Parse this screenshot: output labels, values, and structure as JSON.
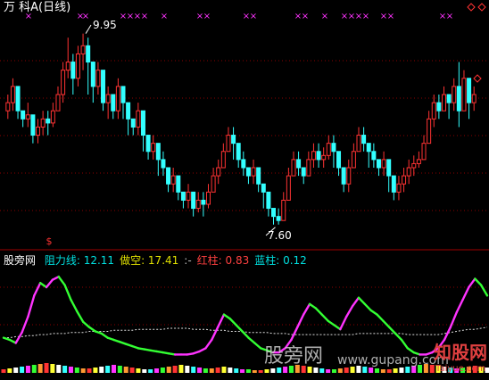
{
  "header": {
    "title": "万  科A(日线)"
  },
  "annotations": {
    "high": "9.95",
    "low": "7.60"
  },
  "indicator": {
    "name": "股旁网",
    "items": [
      {
        "label": "阻力线: 12.11",
        "color": "#00e0e0"
      },
      {
        "label": "做空: 17.41",
        "color": "#e0e000"
      },
      {
        "label": ":-",
        "color": "#bbbbbb"
      },
      {
        "label": "红柱: 0.83",
        "color": "#ff4040"
      },
      {
        "label": "蓝柱: 0.12",
        "color": "#00e0e0"
      }
    ]
  },
  "watermark": {
    "left": "股旁网",
    "site": "www.gupang.com",
    "right": "知股网",
    "right_sub": "Taiyue.com"
  },
  "colors": {
    "up": "#ff3333",
    "down": "#33ffff",
    "grid": "#8b0000",
    "magenta": "#ff33ff",
    "green": "#33ff33"
  },
  "chart_data": [
    {
      "type": "candlestick",
      "title": "万  科A(日线)",
      "ylim": [
        7.4,
        10.1
      ],
      "high_mark": 9.95,
      "low_mark": 7.6,
      "signal_marker": "$",
      "close": [
        9.1,
        9.3,
        9.0,
        8.9,
        8.95,
        8.7,
        8.8,
        8.9,
        8.85,
        9.0,
        9.2,
        9.5,
        9.6,
        9.4,
        9.7,
        9.8,
        9.6,
        9.3,
        9.5,
        9.1,
        9.2,
        9.0,
        9.3,
        9.1,
        8.9,
        8.8,
        9.0,
        8.7,
        8.5,
        8.6,
        8.4,
        8.3,
        8.1,
        8.2,
        8.0,
        7.9,
        8.0,
        7.8,
        7.9,
        7.85,
        8.0,
        8.2,
        8.3,
        8.5,
        8.7,
        8.6,
        8.4,
        8.3,
        8.2,
        8.3,
        8.1,
        8.0,
        7.8,
        7.7,
        7.65,
        7.9,
        8.2,
        8.4,
        8.3,
        8.2,
        8.4,
        8.5,
        8.4,
        8.45,
        8.6,
        8.5,
        8.3,
        8.1,
        8.3,
        8.5,
        8.7,
        8.6,
        8.5,
        8.4,
        8.3,
        8.4,
        8.2,
        8.0,
        8.1,
        8.2,
        8.3,
        8.35,
        8.4,
        8.6,
        8.9,
        9.1,
        9.0,
        9.2,
        9.1,
        9.3,
        9.0,
        9.4,
        9.1,
        9.2
      ],
      "high": [
        9.2,
        9.4,
        9.3,
        9.0,
        9.1,
        8.9,
        8.9,
        9.0,
        9.0,
        9.1,
        9.3,
        9.6,
        9.9,
        9.7,
        9.8,
        9.95,
        9.9,
        9.5,
        9.6,
        9.5,
        9.3,
        9.2,
        9.4,
        9.3,
        9.1,
        8.9,
        9.1,
        9.0,
        8.7,
        8.7,
        8.6,
        8.5,
        8.3,
        8.3,
        8.2,
        8.0,
        8.1,
        8.0,
        8.0,
        8.0,
        8.1,
        8.3,
        8.4,
        8.6,
        8.8,
        8.8,
        8.6,
        8.5,
        8.3,
        8.4,
        8.3,
        8.1,
        8.0,
        7.8,
        7.8,
        8.0,
        8.3,
        8.5,
        8.5,
        8.3,
        8.5,
        8.6,
        8.6,
        8.55,
        8.7,
        8.7,
        8.5,
        8.3,
        8.4,
        8.6,
        8.8,
        8.8,
        8.6,
        8.6,
        8.4,
        8.5,
        8.4,
        8.1,
        8.2,
        8.3,
        8.4,
        8.45,
        8.5,
        8.7,
        9.0,
        9.2,
        9.2,
        9.3,
        9.2,
        9.4,
        9.6,
        9.5,
        9.4,
        9.3
      ],
      "low": [
        8.9,
        9.0,
        8.9,
        8.8,
        8.8,
        8.6,
        8.6,
        8.7,
        8.7,
        8.8,
        9.0,
        9.1,
        9.4,
        9.2,
        9.3,
        9.5,
        9.2,
        9.1,
        9.2,
        9.0,
        8.9,
        8.9,
        8.9,
        8.9,
        8.7,
        8.7,
        8.7,
        8.5,
        8.4,
        8.4,
        8.2,
        8.2,
        8.0,
        8.0,
        7.9,
        7.8,
        7.8,
        7.7,
        7.75,
        7.7,
        7.8,
        8.0,
        8.1,
        8.3,
        8.5,
        8.4,
        8.3,
        8.2,
        8.1,
        8.1,
        8.0,
        7.8,
        7.7,
        7.6,
        7.6,
        7.7,
        7.9,
        8.2,
        8.2,
        8.1,
        8.2,
        8.3,
        8.3,
        8.3,
        8.4,
        8.3,
        8.2,
        8.0,
        8.0,
        8.3,
        8.5,
        8.5,
        8.3,
        8.3,
        8.2,
        8.2,
        8.0,
        7.9,
        7.9,
        8.0,
        8.1,
        8.2,
        8.3,
        8.4,
        8.6,
        8.8,
        8.9,
        9.0,
        8.9,
        9.0,
        8.8,
        9.0,
        8.9,
        9.0
      ]
    },
    {
      "type": "line",
      "title": "股旁网",
      "ylim": [
        0,
        100
      ],
      "series": [
        {
          "name": "阻力线",
          "values": [
            30,
            28,
            25,
            35,
            50,
            70,
            82,
            78,
            85,
            88,
            80,
            66,
            55,
            45,
            40,
            36,
            34,
            30,
            28,
            26,
            24,
            22,
            20,
            19,
            18,
            17,
            16,
            15,
            14,
            14,
            14,
            15,
            17,
            20,
            28,
            40,
            52,
            48,
            42,
            36,
            30,
            25,
            20,
            18,
            16,
            16,
            20,
            28,
            40,
            52,
            62,
            58,
            52,
            46,
            42,
            38,
            50,
            60,
            68,
            62,
            56,
            52,
            46,
            40,
            34,
            28,
            20,
            16,
            14,
            14,
            16,
            20,
            28,
            40,
            54,
            66,
            78,
            86,
            80,
            70
          ]
        },
        {
          "name": "做空",
          "values": [
            30,
            30,
            31,
            31,
            32,
            32,
            33,
            33,
            34,
            34,
            34,
            35,
            35,
            35,
            36,
            36,
            36,
            36,
            37,
            37,
            37,
            37,
            38,
            38,
            38,
            38,
            38,
            39,
            39,
            39,
            39,
            38,
            38,
            38,
            37,
            37,
            37,
            36,
            36,
            36,
            35,
            35,
            35,
            35,
            34,
            34,
            34,
            33,
            33,
            33,
            33,
            33,
            33,
            33,
            33,
            33,
            33,
            33,
            34,
            34,
            34,
            34,
            34,
            34,
            34,
            34,
            33,
            33,
            33,
            33,
            33,
            33,
            34,
            35,
            36,
            37,
            38,
            38,
            39,
            40
          ]
        }
      ],
      "bars": [
        4,
        5,
        6,
        7,
        8,
        9,
        10,
        11,
        10,
        9,
        8,
        7,
        6,
        5,
        5,
        6,
        7,
        8,
        9,
        8,
        7,
        6,
        5,
        4,
        4,
        5,
        6,
        7,
        8,
        9,
        8,
        7,
        6,
        5,
        5,
        6,
        7,
        6,
        5,
        4,
        4,
        3,
        3,
        4,
        5,
        6,
        7,
        8,
        9,
        8,
        7,
        6,
        5,
        4,
        4,
        5,
        6,
        7,
        8,
        7,
        6,
        5,
        4,
        4,
        5,
        6,
        7,
        8,
        9,
        10,
        9,
        8,
        7,
        6,
        5,
        6,
        7,
        8,
        7,
        6
      ]
    }
  ]
}
